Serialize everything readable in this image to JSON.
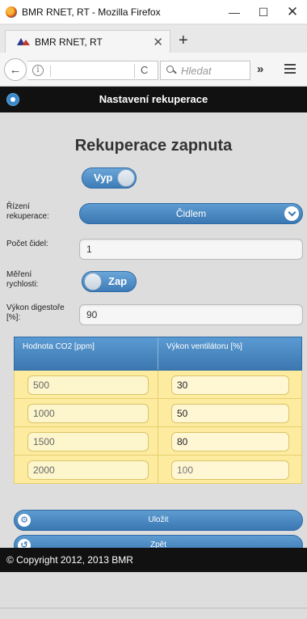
{
  "browser": {
    "window_title": "BMR RNET, RT - Mozilla Firefox",
    "tab_title": "BMR RNET, RT",
    "search_placeholder": "Hledat",
    "min_glyph": "—",
    "max_glyph": "☐",
    "close_glyph": "✕",
    "tab_close_glyph": "✕",
    "new_tab_glyph": "+",
    "back_glyph": "←",
    "reload_glyph": "C",
    "info_glyph": "i",
    "overflow_glyph": "»"
  },
  "header": {
    "title": "Nastavení rekuperace"
  },
  "main": {
    "status_title": "Rekuperace zapnuta",
    "power_toggle_label": "Vyp",
    "control_label": "Řízení rekuperace:",
    "control_value": "Čidlem",
    "sensor_count_label": "Počet čidel:",
    "sensor_count_value": "1",
    "speed_label": "Měření rychlosti:",
    "speed_toggle_label": "Zap",
    "hood_power_label": "Výkon digestoře [%]:",
    "hood_power_value": "90"
  },
  "table": {
    "headers": [
      "Hodnota CO2 [ppm]",
      "Výkon ventilátoru [%]"
    ],
    "rows": [
      {
        "co2": "500",
        "fan": "30"
      },
      {
        "co2": "1000",
        "fan": "50"
      },
      {
        "co2": "1500",
        "fan": "80"
      },
      {
        "co2": "2000",
        "fan": "100"
      }
    ]
  },
  "actions": {
    "save_label": "Uložit",
    "back_label": "Zpět"
  },
  "footer": {
    "copyright": "© Copyright 2012, 2013 BMR"
  },
  "colors": {
    "accent_blue": "#3b78b3",
    "header_black": "#111111",
    "table_yellow": "#fdeca0"
  }
}
